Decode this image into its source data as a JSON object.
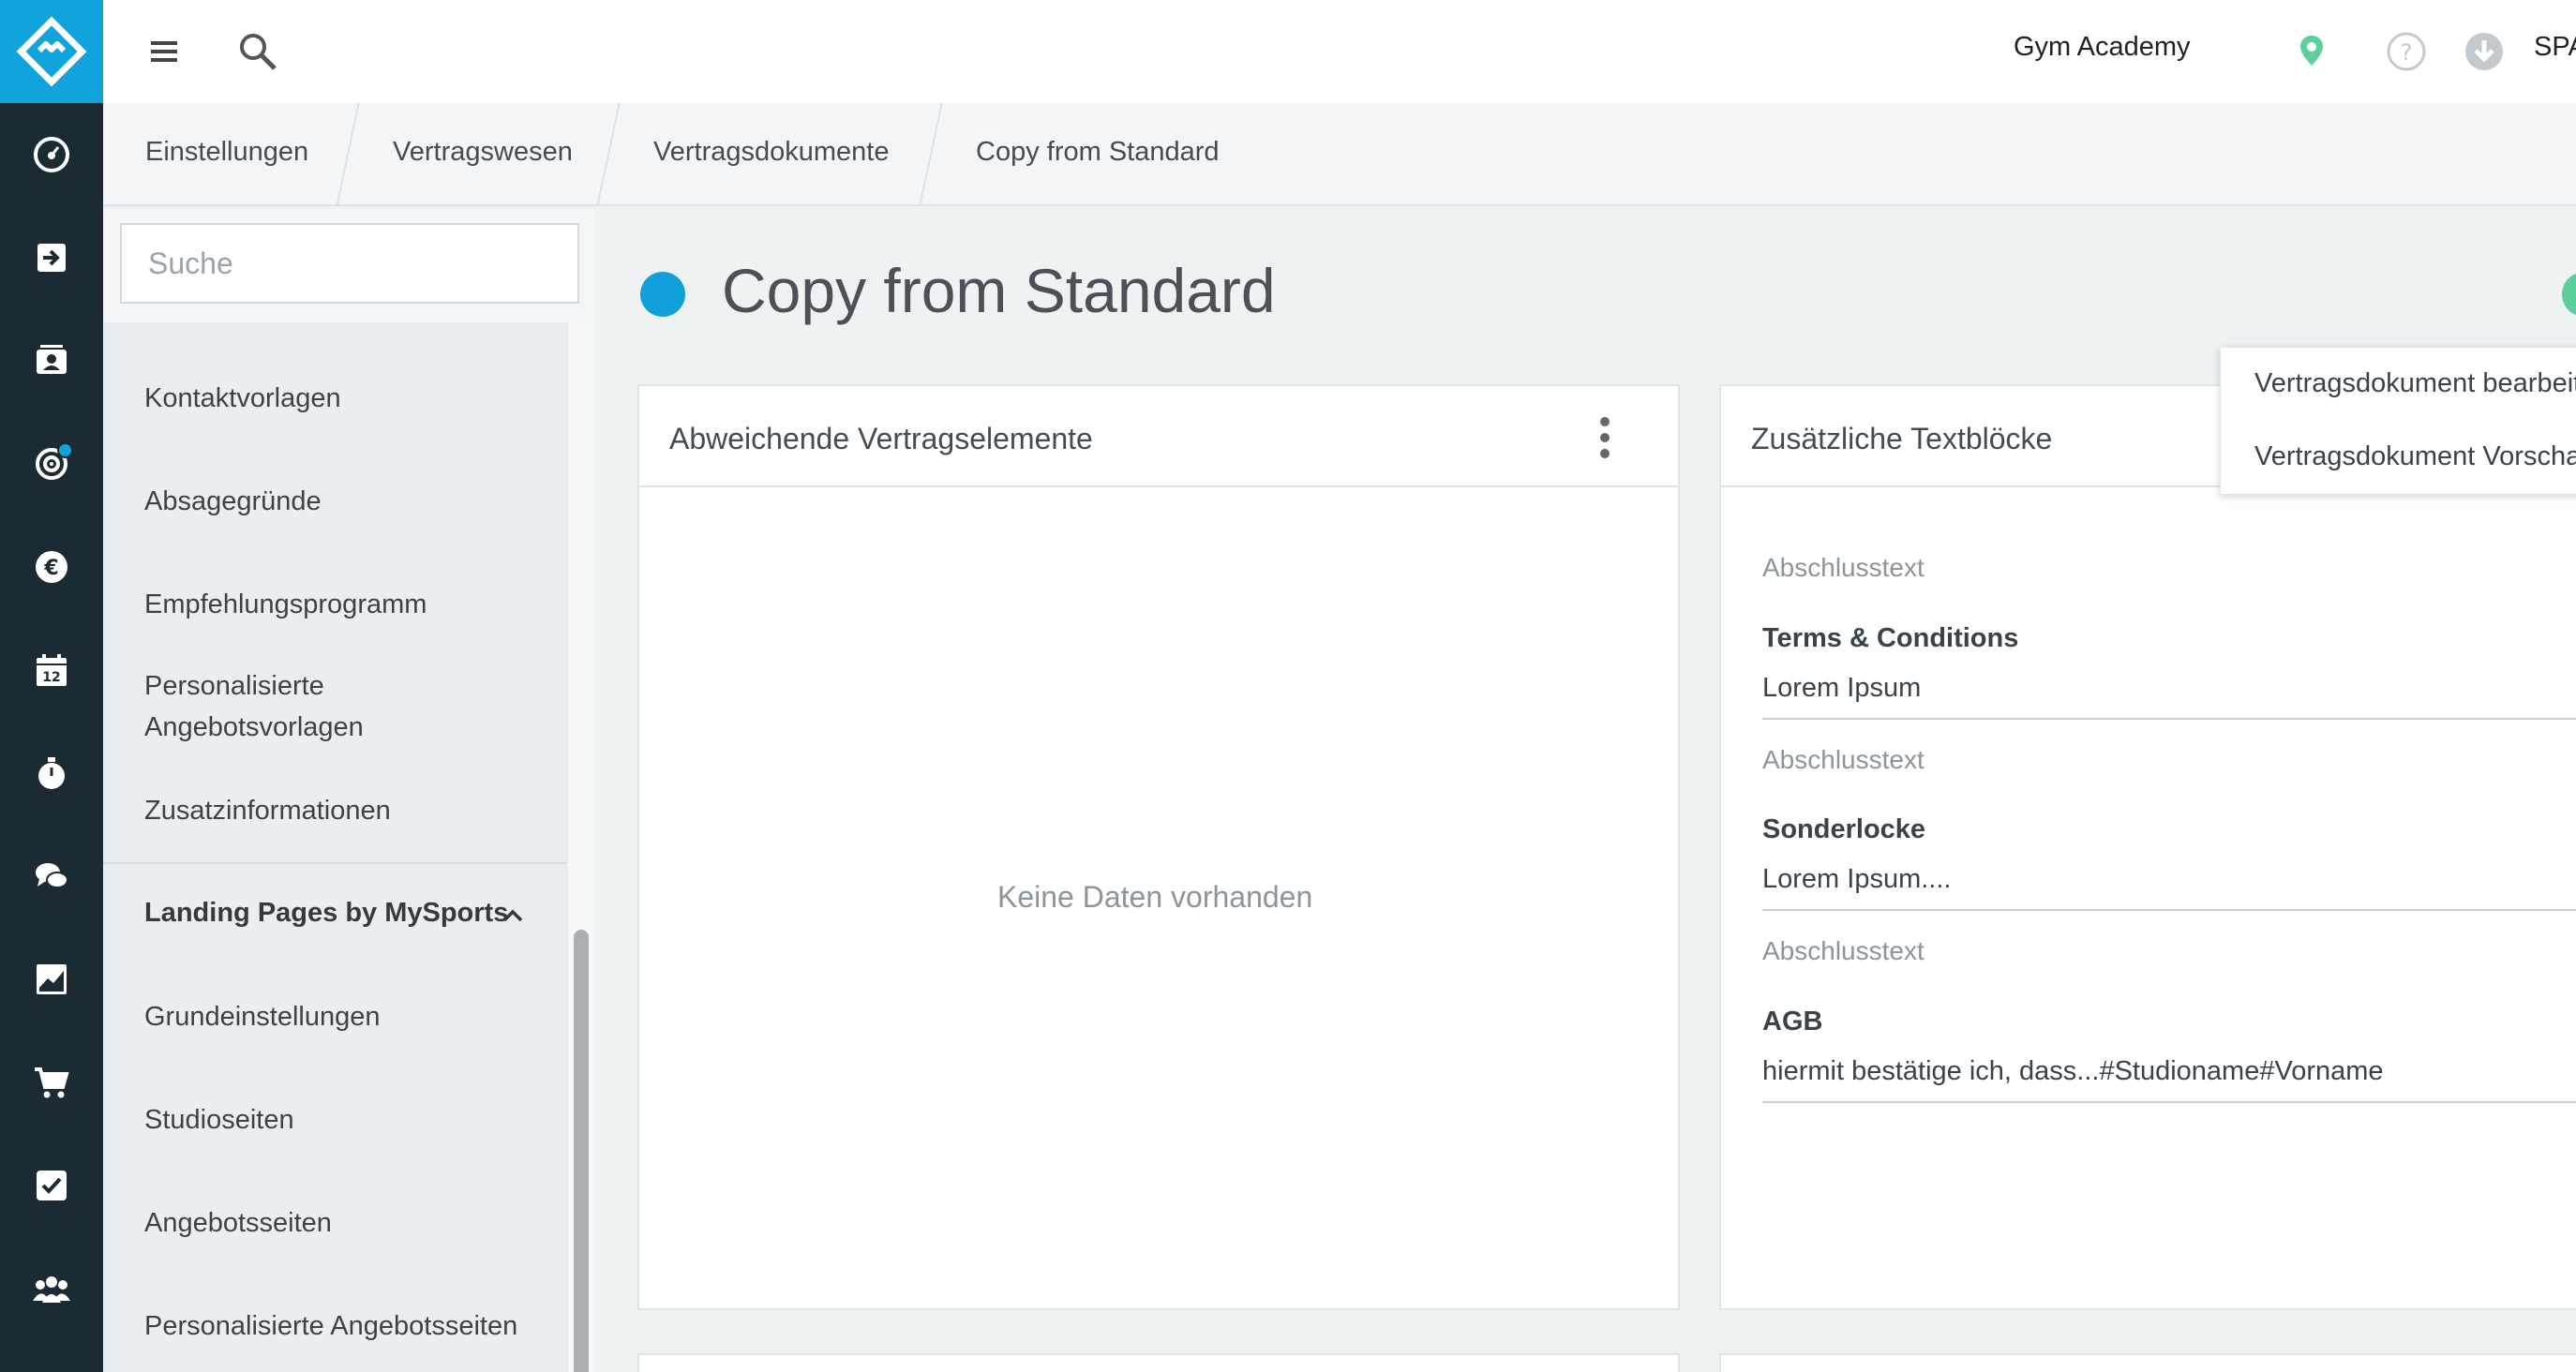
{
  "topbar": {
    "studio_name": "Gym Academy",
    "user_label": "SPA"
  },
  "breadcrumb": [
    "Einstellungen",
    "Vertragswesen",
    "Vertragsdokumente",
    "Copy from Standard"
  ],
  "sidebar": {
    "search_placeholder": "Suche",
    "items_top": [
      "Kontaktvorlagen",
      "Absagegründe",
      "Empfehlungsprogramm",
      "Personalisierte Angebotsvorlagen",
      "Zusatzinformationen"
    ],
    "section": "Landing Pages by MySports",
    "items_section": [
      "Grundeinstellungen",
      "Studioseiten",
      "Angebotsseiten",
      "Personalisierte Angebotsseiten"
    ]
  },
  "rail_icons": [
    "dashboard-icon",
    "check-in-icon",
    "contacts-icon",
    "lead-target-icon",
    "euro-icon",
    "calendar-icon",
    "timer-icon",
    "chat-icon",
    "analytics-icon",
    "shop-cart-icon",
    "tasks-icon",
    "members-icon"
  ],
  "main": {
    "title": "Copy from Standard",
    "card_left": {
      "title": "Abweichende Vertragselemente",
      "empty": "Keine Daten vorhanden"
    },
    "card_right": {
      "title": "Zusätzliche Textblöcke",
      "blocks": [
        {
          "label": "Abschlusstext",
          "name": "Terms & Conditions",
          "value": "Lorem Ipsum"
        },
        {
          "label": "Abschlusstext",
          "name": "Sonderlocke",
          "value": "Lorem Ipsum...."
        },
        {
          "label": "Abschlusstext",
          "name": "AGB",
          "value": "hiermit bestätige ich, dass...#Studioname#Vorname"
        }
      ]
    }
  },
  "dropdown": {
    "items": [
      "Vertragsdokument bearbeiten",
      "Vertragsdokument Vorschau"
    ]
  },
  "colors": {
    "rail": "#1c2a33",
    "accent": "#10a3dc",
    "status_green": "#5dcf9c"
  }
}
